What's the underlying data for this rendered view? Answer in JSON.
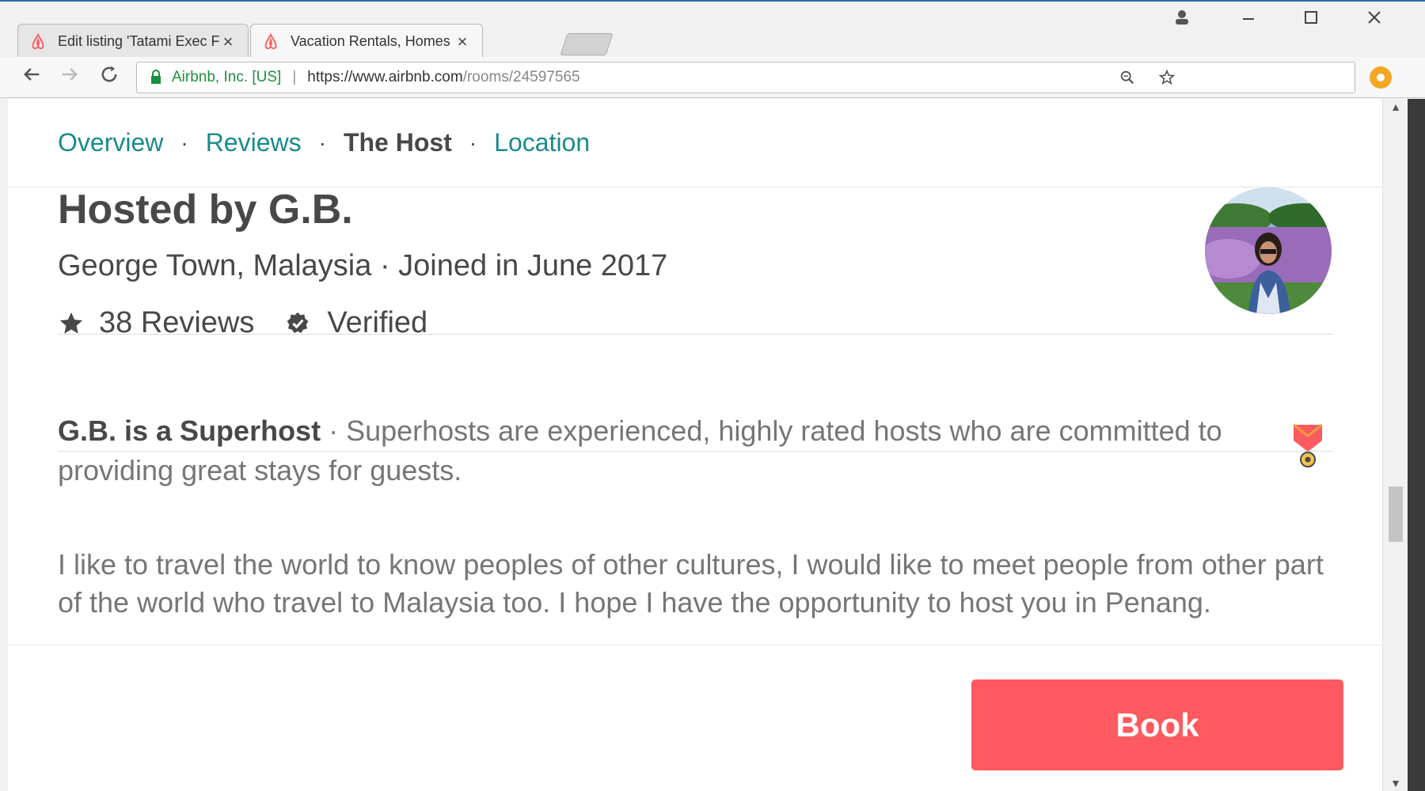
{
  "browser": {
    "tabs": [
      {
        "title": "Edit listing 'Tatami Exec F",
        "active": false
      },
      {
        "title": "Vacation Rentals, Homes",
        "active": true
      }
    ],
    "window_controls": [
      "account-icon",
      "minimize-icon",
      "maximize-icon",
      "close-icon"
    ],
    "address": {
      "security_label": "Airbnb, Inc. [US]",
      "url_main": "https://www.airbnb.com",
      "url_path": "/rooms/24597565"
    },
    "close_glyph": "×"
  },
  "subnav": {
    "items": [
      {
        "label": "Overview",
        "current": false
      },
      {
        "label": "Reviews",
        "current": false
      },
      {
        "label": "The Host",
        "current": true
      },
      {
        "label": "Location",
        "current": false
      }
    ],
    "separator": "·"
  },
  "host": {
    "title": "Hosted by G.B.",
    "location_joined": "George Town, Malaysia · Joined in June 2017",
    "reviews": "38 Reviews",
    "verified": "Verified",
    "superhost_bold": "G.B. is a Superhost",
    "superhost_text": " · Superhosts are experienced, highly rated hosts who are committed to providing great stays for guests.",
    "about": "I like to travel the world to know peoples of other cultures, I would like to meet people from other part of the world who travel to Malaysia too.  I hope I have the opportunity to host you in Penang."
  },
  "booking": {
    "button_label": "Book"
  },
  "colors": {
    "brand": "#ff5a5f",
    "link": "#1a8a8a",
    "text": "#484848",
    "muted": "#767676",
    "secure": "#1e8f3d"
  }
}
